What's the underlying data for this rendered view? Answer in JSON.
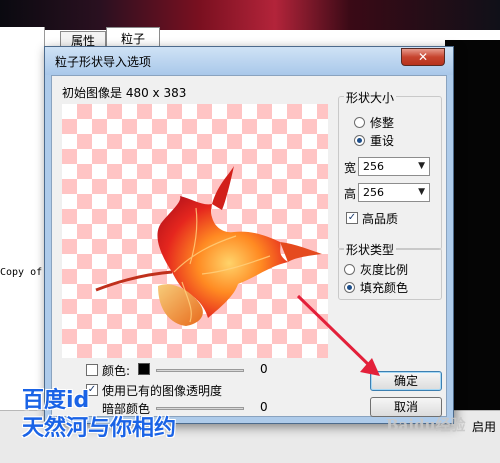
{
  "background": {
    "copy_text": "Copy of",
    "tabs": [
      {
        "label": "属性"
      },
      {
        "label": "粒子"
      }
    ],
    "enable_text": "启用"
  },
  "dialog": {
    "title": "粒子形状导入选项",
    "close_glyph": "✕",
    "image_caption": "初始图像是 480 x 383",
    "shape_size": {
      "title": "形状大小",
      "options": [
        {
          "label": "修整",
          "selected": false
        },
        {
          "label": "重设",
          "selected": true
        }
      ],
      "width_label": "宽",
      "width_value": "256",
      "height_label": "高",
      "height_value": "256",
      "high_quality_label": "高品质",
      "high_quality_checked": true
    },
    "shape_type": {
      "title": "形状类型",
      "options": [
        {
          "label": "灰度比例",
          "selected": false
        },
        {
          "label": "填充颜色",
          "selected": true
        }
      ]
    },
    "color": {
      "label": "颜色:",
      "checked": false,
      "value": "0",
      "swatch": "#000000"
    },
    "use_transparency": {
      "label": "使用已有的图像透明度",
      "checked": true
    },
    "dark_color": {
      "label": "暗部颜色",
      "value": "0"
    },
    "ok_label": "确定",
    "cancel_label": "取消"
  },
  "watermark": {
    "line1": "百度id",
    "line2": "天然河与你相约",
    "logo": "Baidu经验"
  },
  "colors": {
    "accent_arrow": "#e3203a",
    "checker_pink": "#ffc4c4",
    "watermark_blue": "#1a63e6"
  },
  "icons": {
    "close": "close-icon",
    "dropdown": "chevron-down-icon",
    "pointer_arrow": "red-arrow-icon"
  }
}
